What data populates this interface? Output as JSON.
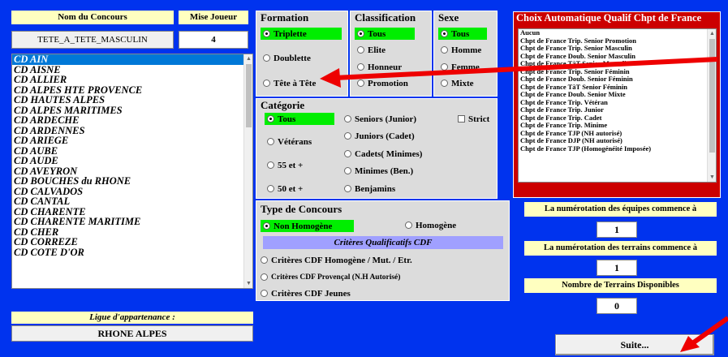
{
  "header": {
    "concours_label": "Nom du Concours",
    "mise_label": "Mise Joueur",
    "concours_value": "TETE_A_TETE_MASCULIN",
    "mise_value": "4"
  },
  "departments": {
    "selected": "CD AIN",
    "items": [
      "CD AIN",
      "CD AISNE",
      "CD ALLIER",
      "CD ALPES HTE PROVENCE",
      "CD HAUTES ALPES",
      "CD ALPES MARITIMES",
      "CD ARDECHE",
      "CD ARDENNES",
      "CD ARIEGE",
      "CD AUBE",
      "CD AUDE",
      "CD AVEYRON",
      "CD BOUCHES du RHONE",
      "CD CALVADOS",
      "CD CANTAL",
      "CD CHARENTE",
      "CD CHARENTE MARITIME",
      "CD CHER",
      "CD CORREZE",
      "CD COTE D'OR"
    ]
  },
  "ligue": {
    "label": "Ligue d'appartenance :",
    "value": "RHONE ALPES"
  },
  "formation": {
    "title": "Formation",
    "options": [
      "Triplette",
      "Doublette",
      "Tête à Tête"
    ],
    "selected": "Triplette"
  },
  "classification": {
    "title": "Classification",
    "options": [
      "Tous",
      "Elite",
      "Honneur",
      "Promotion"
    ],
    "selected": "Tous"
  },
  "sexe": {
    "title": "Sexe",
    "options": [
      "Tous",
      "Homme",
      "Femme",
      "Mixte"
    ],
    "selected": "Tous"
  },
  "categorie": {
    "title": "Catégorie",
    "options": [
      "Tous",
      "Vétérans",
      "55 et +",
      "50 et +",
      "Seniors (Junior)",
      "Juniors (Cadet)",
      "Cadets( Minimes)",
      "Minimes (Ben.)",
      "Benjamins"
    ],
    "selected": "Tous",
    "strict_label": "Strict"
  },
  "type_concours": {
    "title": "Type de Concours",
    "non_homogene": "Non Homogène",
    "homogene": "Homogène",
    "selected": "Non Homogène",
    "criteres_header": "Critères Qualificatifs CDF",
    "criteres": [
      "Critères CDF Homogène / Mut. / Etr.",
      "Critères CDF Provençal (N.H Autorisé)",
      "Critères CDF Jeunes"
    ]
  },
  "qualif": {
    "title": "Choix Automatique Qualif Chpt de France",
    "items": [
      "Aucun",
      "Chpt de France Trip. Senior Promotion",
      "Chpt de France Trip. Senior Masculin",
      "Chpt de France Doub. Senior Masculin",
      "Chpt de France TàT Senior Masculin",
      "Chpt de France Trip. Senior Féminin",
      "Chpt de France Doub. Senior Féminin",
      "Chpt de France TàT Senior Féminin",
      "Chpt de France Doub. Senior Mixte",
      "Chpt de France Trip. Vétéran",
      "Chpt de France Trip. Junior",
      "Chpt de France Trip. Cadet",
      "Chpt de France Trip. Minime",
      "Chpt de France TJP (NH autorisé)",
      "Chpt de France DJP (NH autorisé)",
      "Chpt de France TJP (Homogénéité Imposée)"
    ]
  },
  "numerotation": {
    "equipes_label": "La numérotation des équipes commence à",
    "equipes_value": "1",
    "terrains_label": "La numérotation des terrains commence à",
    "terrains_value": "1",
    "nb_terrains_label": "Nombre de Terrains Disponibles",
    "nb_terrains_value": "0"
  },
  "suite_label": "Suite...",
  "colors": {
    "background": "#0033ee",
    "selected": "#00ee00",
    "qualif_frame": "#cc0000",
    "arrow": "#ee0000",
    "highlight": "#0078d7"
  }
}
